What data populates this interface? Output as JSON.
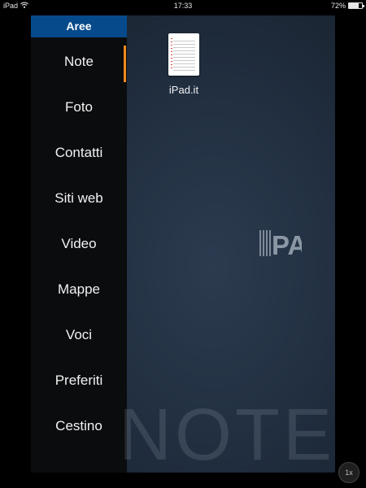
{
  "status_bar": {
    "carrier": "iPad",
    "time": "17:33",
    "battery_percent": "72%",
    "battery_level": 0.72
  },
  "sidebar": {
    "header": "Aree",
    "items": [
      {
        "label": "Note",
        "active": true
      },
      {
        "label": "Foto"
      },
      {
        "label": "Contatti"
      },
      {
        "label": "Siti web"
      },
      {
        "label": "Video"
      },
      {
        "label": "Mappe"
      },
      {
        "label": "Voci"
      },
      {
        "label": "Preferiti"
      },
      {
        "label": "Cestino"
      }
    ]
  },
  "main": {
    "files": [
      {
        "name": "iPad.it",
        "icon": "document-icon"
      }
    ],
    "logo_text": "PA",
    "watermark": "NOTE"
  },
  "zoom": {
    "label": "1x"
  },
  "colors": {
    "accent": "#f08a1d",
    "header_blue": "#064a8c"
  }
}
